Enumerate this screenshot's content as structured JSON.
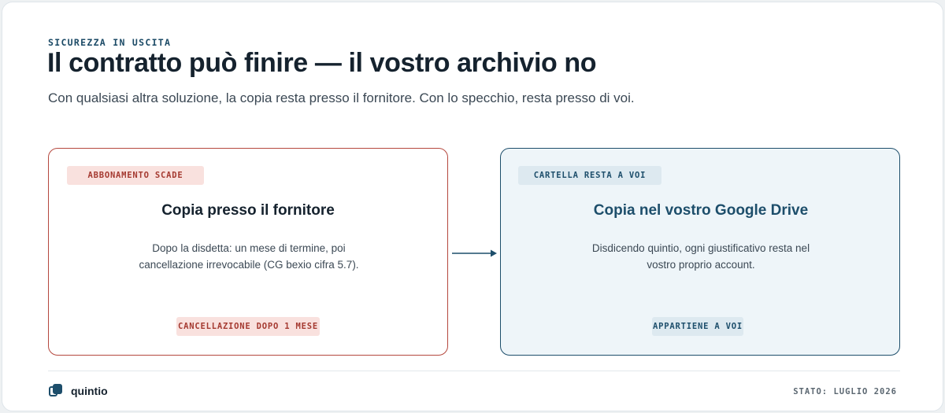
{
  "header": {
    "eyebrow": "SICUREZZA IN USCITA",
    "title": "Il contratto può finire — il vostro archivio no",
    "subtitle": "Con qualsiasi altra soluzione, la copia resta presso il fornitore. Con lo specchio, resta presso di voi."
  },
  "cards": {
    "left": {
      "tag": "ABBONAMENTO SCADE",
      "title": "Copia presso il fornitore",
      "body": "Dopo la disdetta: un mese di termine, poi cancellazione irrevocabile (CG bexio cifra 5.7).",
      "badge": "CANCELLAZIONE DOPO 1 MESE"
    },
    "right": {
      "tag": "CARTELLA RESTA A VOI",
      "title": "Copia nel vostro Google Drive",
      "body": "Disdicendo quintio, ogni giustificativo resta nel vostro proprio account.",
      "badge": "APPARTIENE A VOI"
    }
  },
  "footer": {
    "brand": "quintio",
    "status": "STATO: LUGLIO 2026"
  },
  "colors": {
    "risk": "#b5483e",
    "safe": "#1d4e6b",
    "safe_bg": "#eef5f9"
  },
  "icons": {
    "brand_logo": "stacked-squares-icon",
    "flow_arrow": "arrow-right-icon"
  }
}
